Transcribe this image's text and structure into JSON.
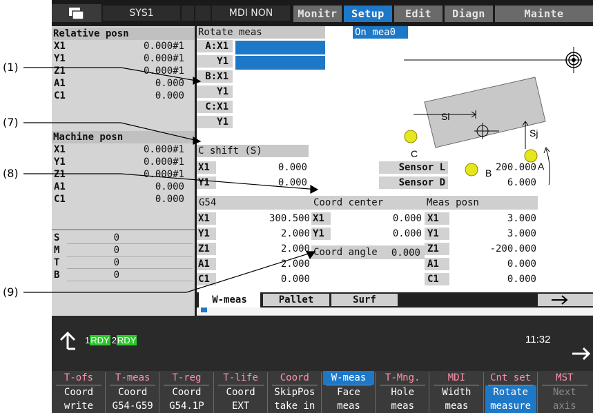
{
  "callouts": [
    "(1)",
    "(7)",
    "(8)",
    "(9)"
  ],
  "header": {
    "system": "SYS1",
    "mode": "MDI NON",
    "menus": [
      {
        "label": "Monitr",
        "active": false
      },
      {
        "label": "Setup",
        "active": true
      },
      {
        "label": "Edit",
        "active": false
      },
      {
        "label": "Diagn",
        "active": false
      },
      {
        "label": "Mainte",
        "active": false
      }
    ]
  },
  "relative": {
    "title": "Relative posn",
    "rows": [
      {
        "axis": "X1",
        "value": "0.000#1"
      },
      {
        "axis": "Y1",
        "value": "0.000#1"
      },
      {
        "axis": "Z1",
        "value": "0.000#1"
      },
      {
        "axis": "A1",
        "value": "0.000"
      },
      {
        "axis": "C1",
        "value": "0.000"
      }
    ]
  },
  "machine": {
    "title": "Machine posn",
    "rows": [
      {
        "axis": "X1",
        "value": "0.000#1"
      },
      {
        "axis": "Y1",
        "value": "0.000#1"
      },
      {
        "axis": "Z1",
        "value": "0.000#1"
      },
      {
        "axis": "A1",
        "value": "0.000"
      },
      {
        "axis": "C1",
        "value": "0.000"
      }
    ]
  },
  "smtb": [
    {
      "key": "S",
      "value": "0"
    },
    {
      "key": "M",
      "value": "0"
    },
    {
      "key": "T",
      "value": "0"
    },
    {
      "key": "B",
      "value": "0"
    }
  ],
  "rotate": {
    "title": "Rotate meas",
    "status": "On mea0",
    "points": [
      "A:X1",
      "Y1",
      "B:X1",
      "Y1",
      "C:X1",
      "Y1"
    ]
  },
  "diagram": {
    "si": "Si",
    "sj": "Sj",
    "a": "A",
    "b": "B",
    "c": "C"
  },
  "cshift": {
    "title": "C shift (S)",
    "rows": [
      {
        "axis": "X1",
        "value": "0.000"
      },
      {
        "axis": "Y1",
        "value": "0.000"
      }
    ]
  },
  "sensor": [
    {
      "label": "Sensor L",
      "value": "200.000"
    },
    {
      "label": "Sensor D",
      "value": "6.000"
    }
  ],
  "table": {
    "g54": {
      "title": "G54",
      "rows": [
        {
          "axis": "X1",
          "value": "300.500"
        },
        {
          "axis": "Y1",
          "value": "2.000"
        },
        {
          "axis": "Z1",
          "value": "2.000"
        },
        {
          "axis": "A1",
          "value": "2.000"
        },
        {
          "axis": "C1",
          "value": "0.000"
        }
      ]
    },
    "coord_center": {
      "title": "Coord center",
      "rows": [
        {
          "axis": "X1",
          "value": "0.000"
        },
        {
          "axis": "Y1",
          "value": "0.000"
        }
      ]
    },
    "coord_angle": {
      "title": "Coord angle",
      "value": "0.000"
    },
    "meas_posn": {
      "title": "Meas posn",
      "rows": [
        {
          "axis": "X1",
          "value": "3.000"
        },
        {
          "axis": "Y1",
          "value": "3.000"
        },
        {
          "axis": "Z1",
          "value": "-200.000"
        },
        {
          "axis": "A1",
          "value": "0.000"
        },
        {
          "axis": "C1",
          "value": "0.000"
        }
      ]
    }
  },
  "subtabs": [
    "W-meas",
    "Pallet",
    "Surf"
  ],
  "status": {
    "rdy1_num": "1",
    "rdy1": "RDY",
    "rdy2_num": "2",
    "rdy2": "RDY",
    "time": "11:32"
  },
  "softkeys": [
    {
      "top": "T-ofs",
      "l1": "Coord",
      "l2": "write"
    },
    {
      "top": "T-meas",
      "l1": "Coord",
      "l2": "G54-G59"
    },
    {
      "top": "T-reg",
      "l1": "Coord",
      "l2": "G54.1P"
    },
    {
      "top": "T-life",
      "l1": "Coord",
      "l2": "EXT"
    },
    {
      "top": "Coord",
      "l1": "SkipPos",
      "l2": "take in"
    },
    {
      "top": "W-meas",
      "l1": "Face",
      "l2": "meas"
    },
    {
      "top": "T-Mng.",
      "l1": "Hole",
      "l2": "meas"
    },
    {
      "top": "MDI",
      "l1": "Width",
      "l2": "meas"
    },
    {
      "top": "Cnt set",
      "l1": "Rotate",
      "l2": "measure"
    },
    {
      "top": "MST",
      "l1": "Next",
      "l2": "axis"
    }
  ],
  "colors": {
    "accent": "#1e78c8",
    "softkey_top": "#ff8fa8",
    "rdy_green": "#2ec62e"
  }
}
